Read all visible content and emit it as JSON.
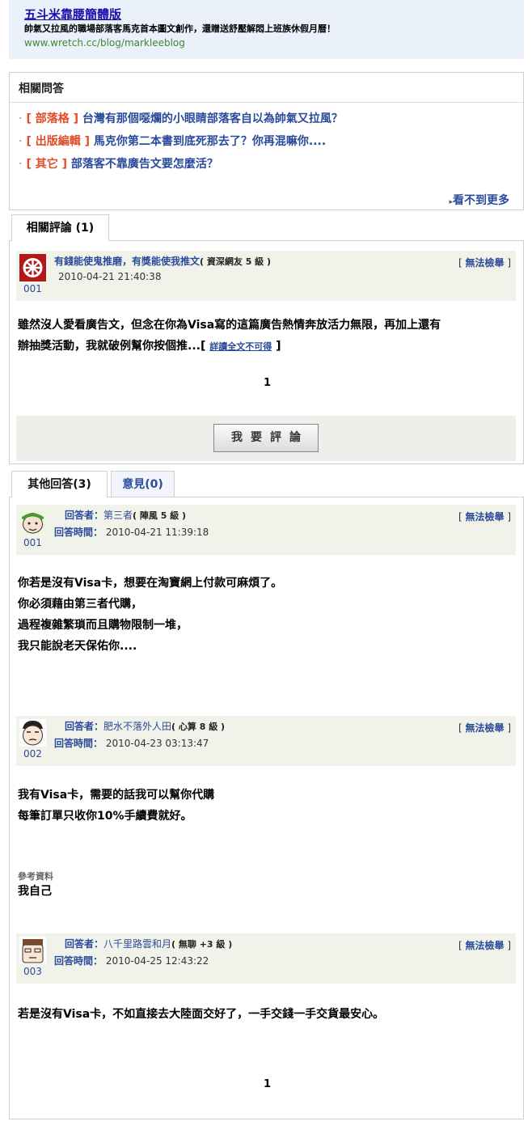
{
  "ad": {
    "title": "五斗米靠腰簡體版",
    "desc": "帥氣又拉風的職場部落客馬克首本圖文創作，還贈送舒壓解悶上班族休假月曆！",
    "url": "www.wretch.cc/blog/markleeblog"
  },
  "related_qa": {
    "heading": "相關問答",
    "items": [
      {
        "cat": "[ 部落格 ]",
        "q": "台灣有那個噁爛的小眼睛部落客自以為帥氣又拉風？"
      },
      {
        "cat": "[ 出版編輯 ]",
        "q": "馬克你第二本書到底死那去了？你再混嘛你...."
      },
      {
        "cat": "[ 其它 ]",
        "q": "部落客不靠廣告文要怎麼活？"
      }
    ],
    "more": "看不到更多"
  },
  "comments": {
    "tab": "相關評論 (1)",
    "entry": {
      "name": "有錢能使鬼推磨，有獎能使我推文",
      "rank": "( 資深網友 5 級 )",
      "time": "2010-04-21 21:40:38",
      "num": "001",
      "report": "無法檢舉",
      "line1": "雖然沒人愛看廣告文，但念在你為Visa寫的這篇廣告熱情奔放活力無限，再加上還有",
      "line2": "辦抽獎活動，我就破例幫你按個推...",
      "readmore": "詳讀全文不可得"
    },
    "page": "1",
    "button": "我要評論"
  },
  "answers": {
    "tab_active": "其他回答(3)",
    "tab_inactive": "意見(0)",
    "answerer_label": "回答者：",
    "time_label": "回答時間：",
    "report": "無法檢舉",
    "ref_label": "參考資料",
    "page": "1",
    "items": [
      {
        "name": "第三者",
        "rank": "( 陣風 5 級 )",
        "time": "2010-04-21 11:39:18",
        "num": "001",
        "lines": [
          "你若是沒有Visa卡，想要在淘寶網上付款可麻煩了。",
          "你必須藉由第三者代購，",
          "過程複雜繁瑣而且購物限制一堆，",
          "我只能說老天保佑你...."
        ]
      },
      {
        "name": "肥水不落外人田",
        "rank": "( 心算 8 級 )",
        "time": "2010-04-23 03:13:47",
        "num": "002",
        "lines": [
          "我有Visa卡，需要的話我可以幫你代購",
          "每筆訂單只收你10%手續費就好。"
        ],
        "ref": "我自己"
      },
      {
        "name": "八千里路雲和月",
        "rank": "( 無聊 +3 級 )",
        "time": "2010-04-25 12:43:22",
        "num": "003",
        "lines": [
          "若是沒有Visa卡，不如直接去大陸面交好了，一手交錢一手交貨最安心。"
        ]
      }
    ]
  }
}
